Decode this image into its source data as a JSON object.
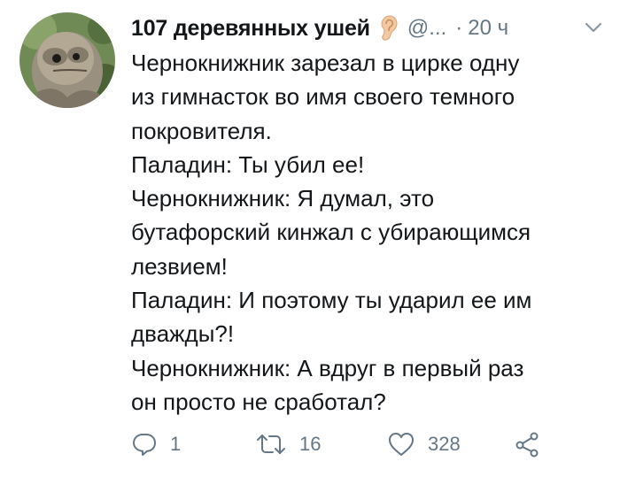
{
  "author": {
    "display_name": "107 деревянных ушей",
    "handle": "@...",
    "separator": "·",
    "time": "20 ч"
  },
  "tweet": {
    "lines": [
      "Чернокнижник зарезал в цирке одну",
      "из гимнасток во имя своего темного",
      "покровителя.",
      "Паладин: Ты убил ее!",
      "Чернокнижник: Я думал, это",
      "бутафорский кинжал с убирающимся",
      "лезвием!",
      "Паладин: И поэтому ты ударил ее им",
      "дважды?!",
      "Чернокнижник: А вдруг в первый раз",
      "он просто не сработал?"
    ]
  },
  "actions": {
    "reply_count": "1",
    "retweet_count": "16",
    "like_count": "328"
  },
  "icons": {
    "avatar": "owl-avatar",
    "name_emoji": "ear-icon",
    "menu": "chevron-down-icon",
    "reply": "reply-icon",
    "retweet": "retweet-icon",
    "like": "heart-icon",
    "share": "share-icon"
  },
  "colors": {
    "text": "#14171a",
    "secondary": "#657786"
  }
}
